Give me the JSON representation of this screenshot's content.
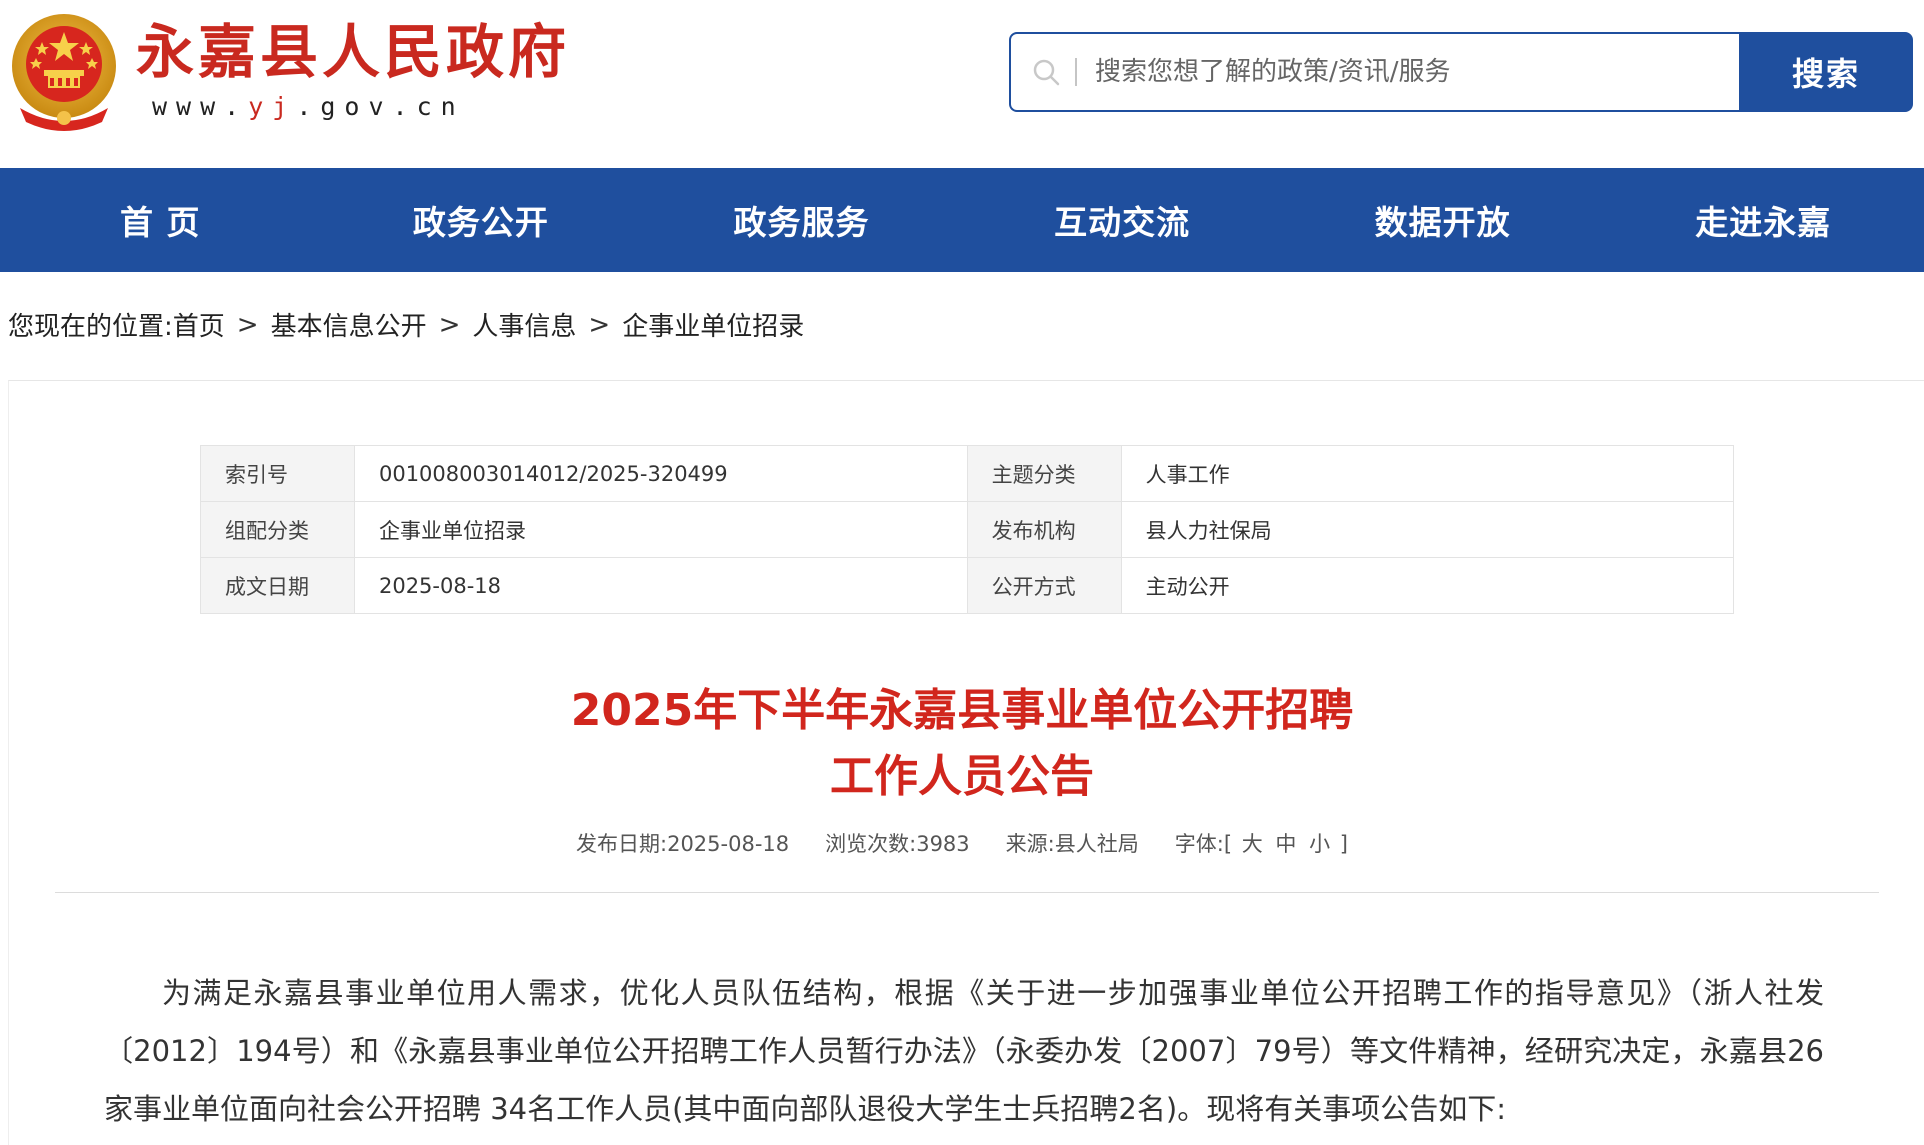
{
  "header": {
    "site_title": "永嘉县人民政府",
    "url_prefix": "www.",
    "url_highlight": "yj",
    "url_suffix": ".gov.cn",
    "emblem_icon": "national-emblem-icon",
    "search": {
      "placeholder": "搜索您想了解的政策/资讯/服务",
      "value": "",
      "button_label": "搜索",
      "icon": "search-icon"
    }
  },
  "colors": {
    "brand_blue": "#1f4f9e",
    "title_red": "#d1261d",
    "site_red": "#c9291f"
  },
  "nav": {
    "items": [
      {
        "label": "首 页"
      },
      {
        "label": "政务公开"
      },
      {
        "label": "政务服务"
      },
      {
        "label": "互动交流"
      },
      {
        "label": "数据开放"
      },
      {
        "label": "走进永嘉"
      }
    ]
  },
  "breadcrumb": {
    "prefix": "您现在的位置:",
    "items": [
      "首页",
      "基本信息公开",
      "人事信息",
      "企事业单位招录"
    ],
    "separator": ">"
  },
  "meta": {
    "rows": [
      {
        "l1": "索引号",
        "v1": "001008003014012/2025-320499",
        "l2": "主题分类",
        "v2": "人事工作"
      },
      {
        "l1": "组配分类",
        "v1": "企事业单位招录",
        "l2": "发布机构",
        "v2": "县人力社保局"
      },
      {
        "l1": "成文日期",
        "v1": "2025-08-18",
        "l2": "公开方式",
        "v2": "主动公开"
      }
    ]
  },
  "article": {
    "title_line1": "2025年下半年永嘉县事业单位公开招聘",
    "title_line2": "工作人员公告",
    "publish_date": "发布日期:2025-08-18",
    "views": "浏览次数:3983",
    "source": "来源:县人社局",
    "font_label": "字体:[",
    "font_large": "大",
    "font_medium": "中",
    "font_small": "小",
    "font_close": "]",
    "paragraph1": "为满足永嘉县事业单位用人需求，优化人员队伍结构，根据《关于进一步加强事业单位公开招聘工作的指导意见》（浙人社发〔2012〕194号）和《永嘉县事业单位公开招聘工作人员暂行办法》（永委办发〔2007〕79号）等文件精神，经研究决定，永嘉县26家事业单位面向社会公开招聘 34名工作人员(其中面向部队退役大学生士兵招聘2名)。现将有关事项公告如下:"
  }
}
